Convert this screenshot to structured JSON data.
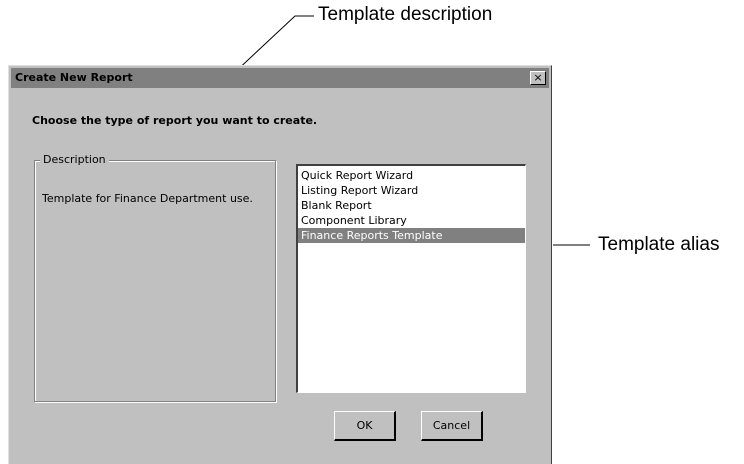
{
  "callouts": {
    "description": "Template description",
    "alias": "Template alias"
  },
  "dialog": {
    "title": "Create New Report",
    "close_glyph": "×",
    "prompt": "Choose the type of report you want to create.",
    "description_group": {
      "legend": "Description",
      "text": "Template for Finance Department use."
    },
    "report_types": [
      {
        "label": "Quick Report Wizard",
        "selected": false
      },
      {
        "label": "Listing Report Wizard",
        "selected": false
      },
      {
        "label": "Blank Report",
        "selected": false
      },
      {
        "label": "Component Library",
        "selected": false
      },
      {
        "label": "Finance Reports Template",
        "selected": true
      }
    ],
    "ok_label": "OK",
    "cancel_label": "Cancel"
  },
  "colors": {
    "dialog_bg": "#c0c0c0",
    "titlebar": "#808080",
    "selection": "#808080"
  }
}
